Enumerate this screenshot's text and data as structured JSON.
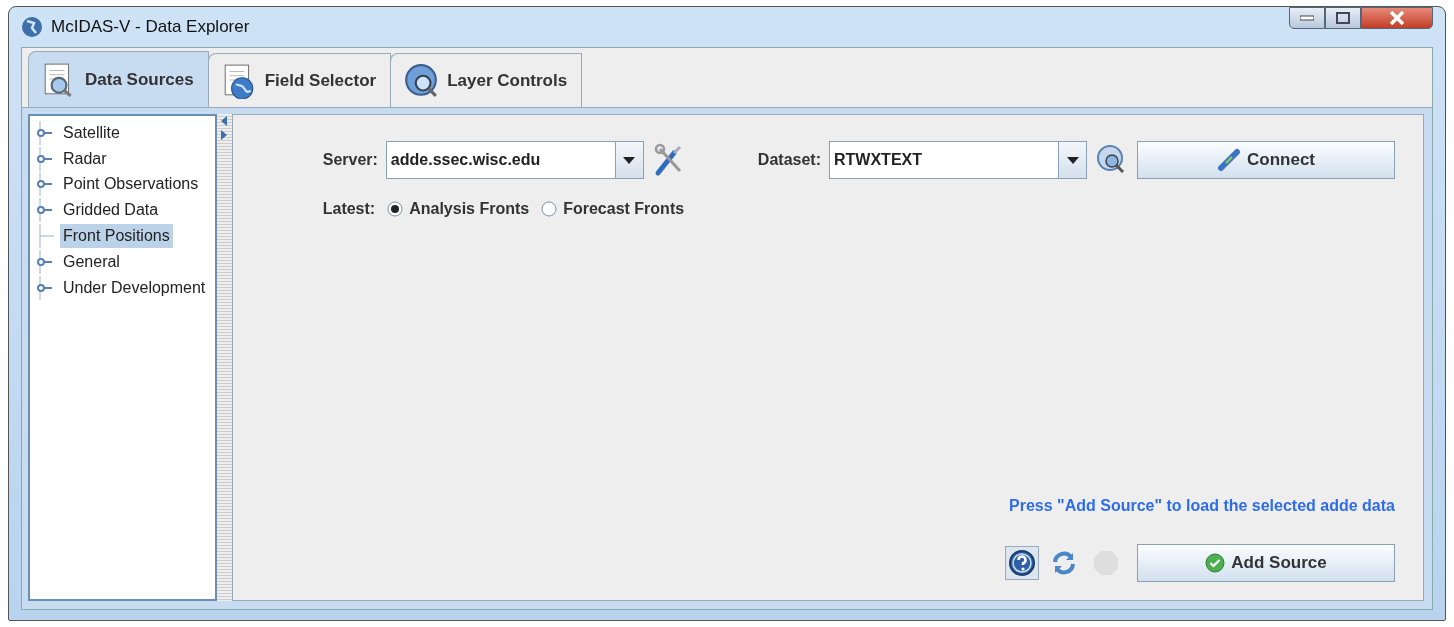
{
  "window": {
    "title": "McIDAS-V - Data Explorer"
  },
  "tabs": [
    {
      "label": "Data Sources",
      "kind": "sources",
      "selected": true
    },
    {
      "label": "Field Selector",
      "kind": "fields",
      "selected": false
    },
    {
      "label": "Layer Controls",
      "kind": "layers",
      "selected": false
    }
  ],
  "tree": {
    "items": [
      {
        "label": "Satellite",
        "kind": "folder",
        "selected": false
      },
      {
        "label": "Radar",
        "kind": "folder",
        "selected": false
      },
      {
        "label": "Point Observations",
        "kind": "folder",
        "selected": false
      },
      {
        "label": "Gridded Data",
        "kind": "folder",
        "selected": false
      },
      {
        "label": "Front Positions",
        "kind": "leaf",
        "selected": true
      },
      {
        "label": "General",
        "kind": "folder",
        "selected": false
      },
      {
        "label": "Under Development",
        "kind": "folder",
        "selected": false
      }
    ]
  },
  "server": {
    "label": "Server:",
    "value": "adde.ssec.wisc.edu"
  },
  "dataset": {
    "label": "Dataset:",
    "value": "RTWXTEXT"
  },
  "connect_button": "Connect",
  "latest": {
    "label": "Latest:",
    "options": [
      {
        "label": "Analysis Fronts",
        "selected": true
      },
      {
        "label": "Forecast Fronts",
        "selected": false
      }
    ]
  },
  "hint": "Press \"Add Source\" to load the selected adde data",
  "tool_buttons": [
    {
      "kind": "help",
      "disabled": false
    },
    {
      "kind": "refresh",
      "disabled": false
    },
    {
      "kind": "stop",
      "disabled": true
    }
  ],
  "add_button": "Add Source"
}
